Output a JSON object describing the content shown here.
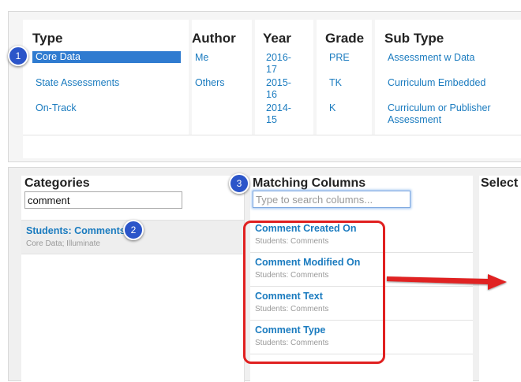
{
  "filters": {
    "type": {
      "header": "Type",
      "options": [
        "Core Data",
        "State Assessments",
        "On-Track"
      ]
    },
    "author": {
      "header": "Author",
      "options": [
        "Me",
        "Others"
      ]
    },
    "year": {
      "header": "Year",
      "options": [
        "2016-17",
        "2015-16",
        "2014-15"
      ]
    },
    "grade": {
      "header": "Grade",
      "options": [
        "PRE",
        "TK",
        "K"
      ]
    },
    "subtype": {
      "header": "Sub Type",
      "options": [
        "Assessment w Data",
        "Curriculum Embedded",
        "Curriculum or Publisher Assessment"
      ]
    }
  },
  "categories": {
    "title": "Categories",
    "search_value": "comment",
    "items": [
      {
        "title": "Students: Comments",
        "subtitle": "Core Data; Illuminate"
      }
    ]
  },
  "matching": {
    "title": "Matching Columns",
    "search_placeholder": "Type to search columns...",
    "items": [
      {
        "title": "Comment Created On",
        "subtitle": "Students: Comments"
      },
      {
        "title": "Comment Modified On",
        "subtitle": "Students: Comments"
      },
      {
        "title": "Comment Text",
        "subtitle": "Students: Comments"
      },
      {
        "title": "Comment Type",
        "subtitle": "Students: Comments"
      }
    ]
  },
  "selected": {
    "title": "Select"
  },
  "annotations": {
    "badge1": "1",
    "badge2": "2",
    "badge3": "3"
  },
  "colors": {
    "link": "#1a7bbf",
    "selected_bg": "#2f7bd0",
    "badge": "#2b55c9",
    "highlight": "#e02020"
  }
}
